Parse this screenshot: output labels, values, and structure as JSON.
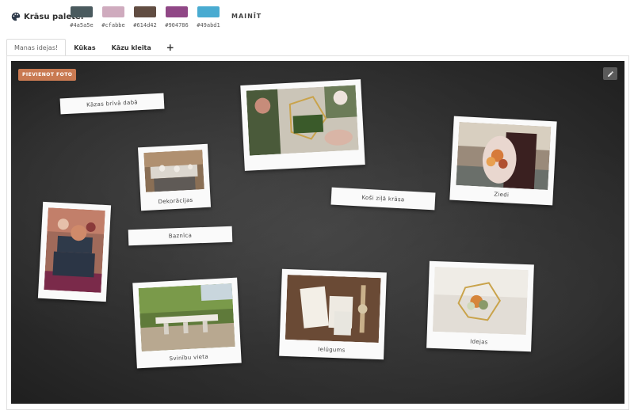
{
  "palette": {
    "label": "Krāsu palete:",
    "edit_label": "MAINĪT",
    "swatches": [
      {
        "code": "#4a5a5e",
        "color": "#4a5a5e"
      },
      {
        "code": "#cfabbe",
        "color": "#cfabbe"
      },
      {
        "code": "#614d42",
        "color": "#614d42"
      },
      {
        "code": "#904786",
        "color": "#904786"
      },
      {
        "code": "#49abd1",
        "color": "#49abd1"
      }
    ]
  },
  "tabs": [
    {
      "label": "Manas idejas!",
      "active": true
    },
    {
      "label": "Kūkas",
      "active": false
    },
    {
      "label": "Kāzu kleita",
      "active": false
    }
  ],
  "tab_add_label": "+",
  "board": {
    "add_photo_label": "PIEVIENOT FOTO",
    "notes": [
      {
        "text": "Kāzas brīvā dabā"
      },
      {
        "text": "Baznīca"
      },
      {
        "text": "Koši ziļā krāsa"
      }
    ],
    "photos": [
      {
        "caption": "Dekorācijas"
      },
      {
        "caption": ""
      },
      {
        "caption": "Ziedi"
      },
      {
        "caption": ""
      },
      {
        "caption": "Svinību vieta"
      },
      {
        "caption": "Ielūgums"
      },
      {
        "caption": "Idejas"
      }
    ]
  },
  "icons": {
    "palette": "palette-icon",
    "edit": "pencil-icon"
  }
}
